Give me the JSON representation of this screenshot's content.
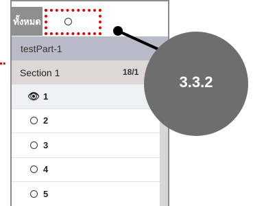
{
  "filter": {
    "all_label": "ทั้งหมด"
  },
  "part": {
    "label": "testPart-1"
  },
  "section": {
    "label": "Section 1",
    "count": "18/1"
  },
  "items": [
    {
      "label": "1",
      "icon": "eye-icon",
      "current": true
    },
    {
      "label": "2",
      "icon": "radio-icon",
      "current": false
    },
    {
      "label": "3",
      "icon": "radio-icon",
      "current": false
    },
    {
      "label": "4",
      "icon": "radio-icon",
      "current": false
    },
    {
      "label": "5",
      "icon": "radio-icon",
      "current": false
    }
  ],
  "callout": {
    "label": "3.3.2",
    "color": "#6e6e6e"
  },
  "highlight_color": "#e00000"
}
